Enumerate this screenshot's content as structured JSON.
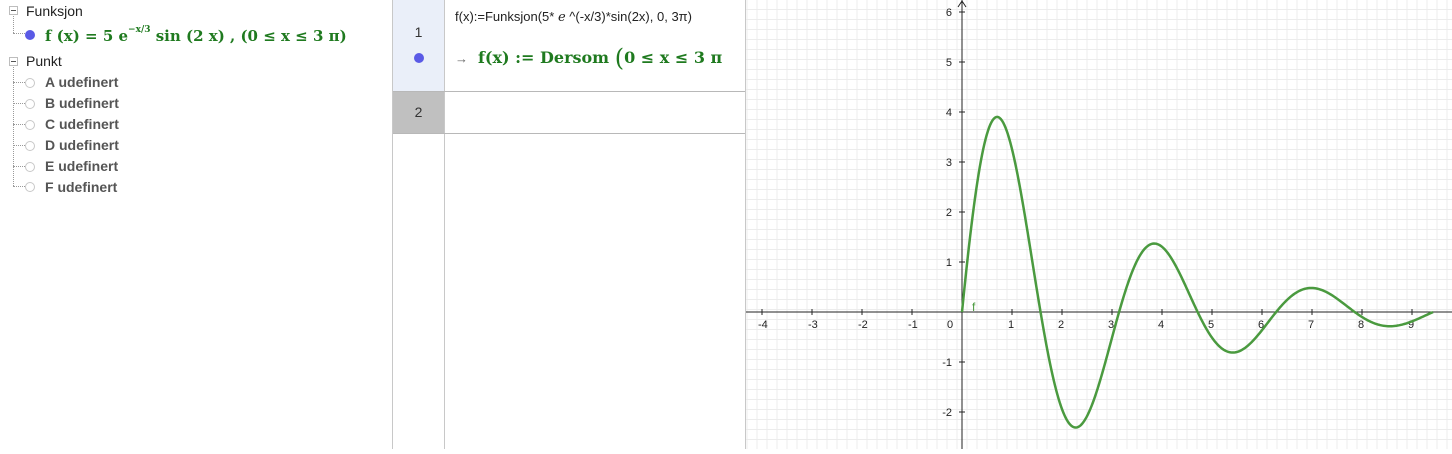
{
  "algebra": {
    "categories": [
      {
        "label": "Funksjon"
      },
      {
        "label": "Punkt"
      }
    ],
    "function_item": {
      "text_a": "f (x)  =  5 e",
      "exponent": "−x/3",
      "text_b": " sin (2 x) ,      (0 ≤ x ≤ 3 π)"
    },
    "points": [
      {
        "label": "A udefinert"
      },
      {
        "label": "B udefinert"
      },
      {
        "label": "C udefinert"
      },
      {
        "label": "D udefinert"
      },
      {
        "label": "E udefinert"
      },
      {
        "label": "F udefinert"
      }
    ]
  },
  "cas": {
    "rows": [
      {
        "number": "1",
        "input_a": "f(x):=Funksjon(5* ",
        "input_e": "e",
        "input_b": " ^(-x/3)*sin(2x), 0,  3π)",
        "output_arrow": "→",
        "output_text": "f(x)  :=  Dersom ",
        "output_paren": "(",
        "output_tail": "0 ≤ x ≤ 3 π"
      },
      {
        "number": "2"
      }
    ]
  },
  "graphics": {
    "function_label": "f",
    "curve_color": "#4a9a3f",
    "x_ticks": [
      "-4",
      "-3",
      "-2",
      "-1",
      "0",
      "1",
      "2",
      "3",
      "4",
      "5",
      "6",
      "7",
      "8",
      "9"
    ],
    "y_ticks": [
      "6",
      "5",
      "4",
      "3",
      "2",
      "1",
      "-1",
      "-2"
    ]
  },
  "chart_data": {
    "type": "line",
    "title": "",
    "xlabel": "",
    "ylabel": "",
    "xlim": [
      -4.3,
      9.8
    ],
    "ylim": [
      -2.75,
      6.2
    ],
    "grid": true,
    "series": [
      {
        "name": "f",
        "expression": "5*e^(-x/3)*sin(2x)",
        "domain": [
          0,
          9.42
        ],
        "x": [
          0,
          0.3,
          0.65,
          1.0,
          1.3,
          1.57,
          1.9,
          2.22,
          2.6,
          3.14,
          3.5,
          3.8,
          4.2,
          4.71,
          5.1,
          5.36,
          5.8,
          6.28,
          6.6,
          6.9,
          7.3,
          7.85,
          8.2,
          8.5,
          9.0,
          9.42
        ],
        "y": [
          0,
          2.67,
          3.89,
          3.26,
          1.41,
          0,
          -1.95,
          -2.31,
          -1.68,
          0,
          1.03,
          1.37,
          0.96,
          0,
          -0.65,
          -0.78,
          -0.56,
          0,
          0.39,
          0.47,
          0.33,
          0,
          -0.23,
          -0.29,
          -0.22,
          0
        ],
        "color": "#4a9a3f"
      }
    ]
  }
}
